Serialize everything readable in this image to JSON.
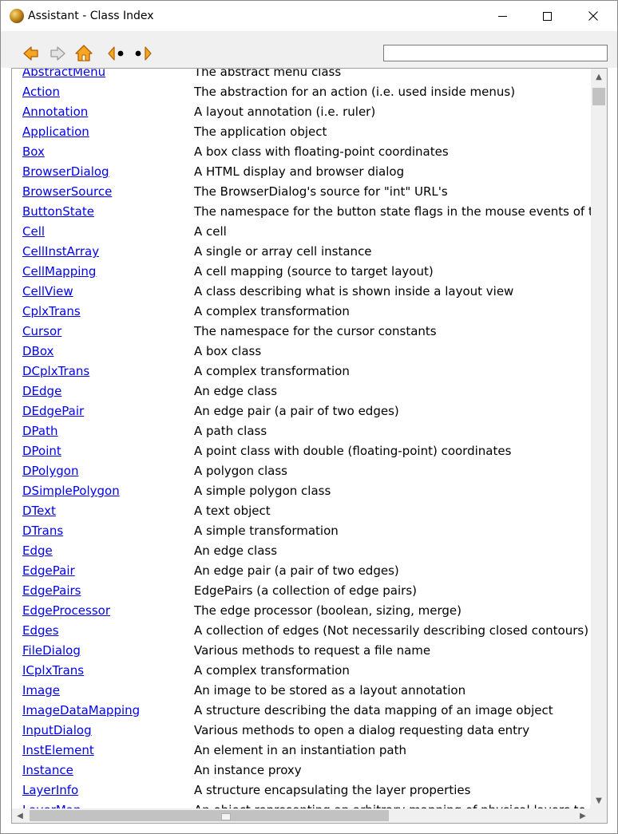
{
  "window": {
    "title": "Assistant - Class Index"
  },
  "toolbar": {
    "search": {
      "value": "",
      "placeholder": ""
    }
  },
  "colors": {
    "link": "#0000ee",
    "toolbar_bg": "#f0f0f0",
    "arrow_fill": "#f5a623",
    "arrow_stroke": "#b06000"
  },
  "class_index": [
    {
      "name": "AbstractMenu",
      "desc": "The abstract menu class"
    },
    {
      "name": "Action",
      "desc": "The abstraction for an action (i.e. used inside menus)"
    },
    {
      "name": "Annotation",
      "desc": "A layout annotation (i.e. ruler)"
    },
    {
      "name": "Application",
      "desc": "The application object"
    },
    {
      "name": "Box",
      "desc": "A box class with floating-point coordinates"
    },
    {
      "name": "BrowserDialog",
      "desc": "A HTML display and browser dialog"
    },
    {
      "name": "BrowserSource",
      "desc": "The BrowserDialog's source for \"int\" URL's"
    },
    {
      "name": "ButtonState",
      "desc": "The namespace for the button state flags in the mouse events of t"
    },
    {
      "name": "Cell",
      "desc": "A cell"
    },
    {
      "name": "CellInstArray",
      "desc": "A single or array cell instance"
    },
    {
      "name": "CellMapping",
      "desc": "A cell mapping (source to target layout)"
    },
    {
      "name": "CellView",
      "desc": "A class describing what is shown inside a layout view"
    },
    {
      "name": "CplxTrans",
      "desc": "A complex transformation"
    },
    {
      "name": "Cursor",
      "desc": "The namespace for the cursor constants"
    },
    {
      "name": "DBox",
      "desc": "A box class"
    },
    {
      "name": "DCplxTrans",
      "desc": "A complex transformation"
    },
    {
      "name": "DEdge",
      "desc": "An edge class"
    },
    {
      "name": "DEdgePair",
      "desc": "An edge pair (a pair of two edges)"
    },
    {
      "name": "DPath",
      "desc": "A path class"
    },
    {
      "name": "DPoint",
      "desc": "A point class with double (floating-point) coordinates"
    },
    {
      "name": "DPolygon",
      "desc": "A polygon class"
    },
    {
      "name": "DSimplePolygon",
      "desc": "A simple polygon class"
    },
    {
      "name": "DText",
      "desc": "A text object"
    },
    {
      "name": "DTrans",
      "desc": "A simple transformation"
    },
    {
      "name": "Edge",
      "desc": "An edge class"
    },
    {
      "name": "EdgePair",
      "desc": "An edge pair (a pair of two edges)"
    },
    {
      "name": "EdgePairs",
      "desc": "EdgePairs (a collection of edge pairs)"
    },
    {
      "name": "EdgeProcessor",
      "desc": "The edge processor (boolean, sizing, merge)"
    },
    {
      "name": "Edges",
      "desc": "A collection of edges (Not necessarily describing closed contours)"
    },
    {
      "name": "FileDialog",
      "desc": "Various methods to request a file name"
    },
    {
      "name": "ICplxTrans",
      "desc": "A complex transformation"
    },
    {
      "name": "Image",
      "desc": "An image to be stored as a layout annotation"
    },
    {
      "name": "ImageDataMapping",
      "desc": "A structure describing the data mapping of an image object"
    },
    {
      "name": "InputDialog",
      "desc": "Various methods to open a dialog requesting data entry"
    },
    {
      "name": "InstElement",
      "desc": "An element in an instantiation path"
    },
    {
      "name": "Instance",
      "desc": "An instance proxy"
    },
    {
      "name": "LayerInfo",
      "desc": "A structure encapsulating the layer properties"
    },
    {
      "name": "LayerMap",
      "desc": "An object representing an arbitrary mapping of physical layers to l"
    }
  ]
}
